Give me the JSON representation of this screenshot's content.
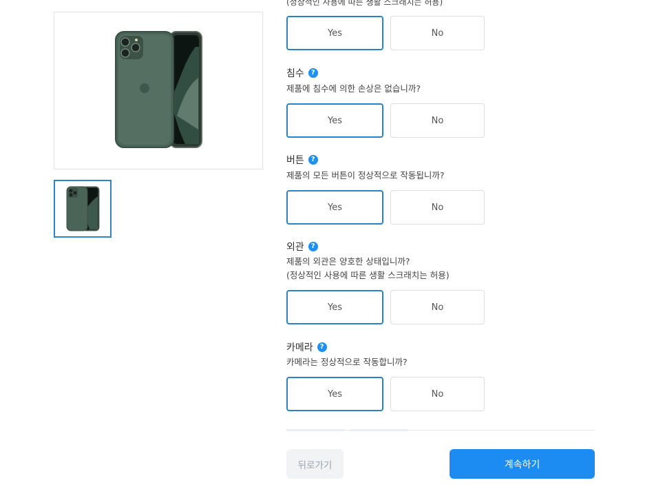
{
  "top_fragment": "(정상적인 사용에 따른 생활 스크래치는 허용)",
  "questions": [
    {
      "title": "",
      "description": [],
      "yes_label": "Yes",
      "no_label": "No"
    },
    {
      "title": "침수",
      "description": [
        "제품에 침수에 의한 손상은 없습니까?"
      ],
      "yes_label": "Yes",
      "no_label": "No"
    },
    {
      "title": "버튼",
      "description": [
        "제품의 모든 버튼이 정상적으로 작동됩니까?"
      ],
      "yes_label": "Yes",
      "no_label": "No"
    },
    {
      "title": "외관",
      "description": [
        "제품의 외관은 양호한 상태입니까?",
        "(정상적인 사용에 따른 생활 스크래치는 허용)"
      ],
      "yes_label": "Yes",
      "no_label": "No"
    },
    {
      "title": "카메라",
      "description": [
        "카메라는 정상적으로 작동합니까?"
      ],
      "yes_label": "Yes",
      "no_label": "No"
    }
  ],
  "help_icon": {
    "glyph": "?",
    "name": "question-circle-icon",
    "color": "#1f8ff0"
  },
  "selected_answer": "Yes",
  "footer": {
    "back_label": "뒤로가기",
    "continue_label": "계속하기"
  },
  "colors": {
    "accent": "#1c8cf2",
    "selected_border": "#2a82c4",
    "phone_body": "#4a6458"
  }
}
